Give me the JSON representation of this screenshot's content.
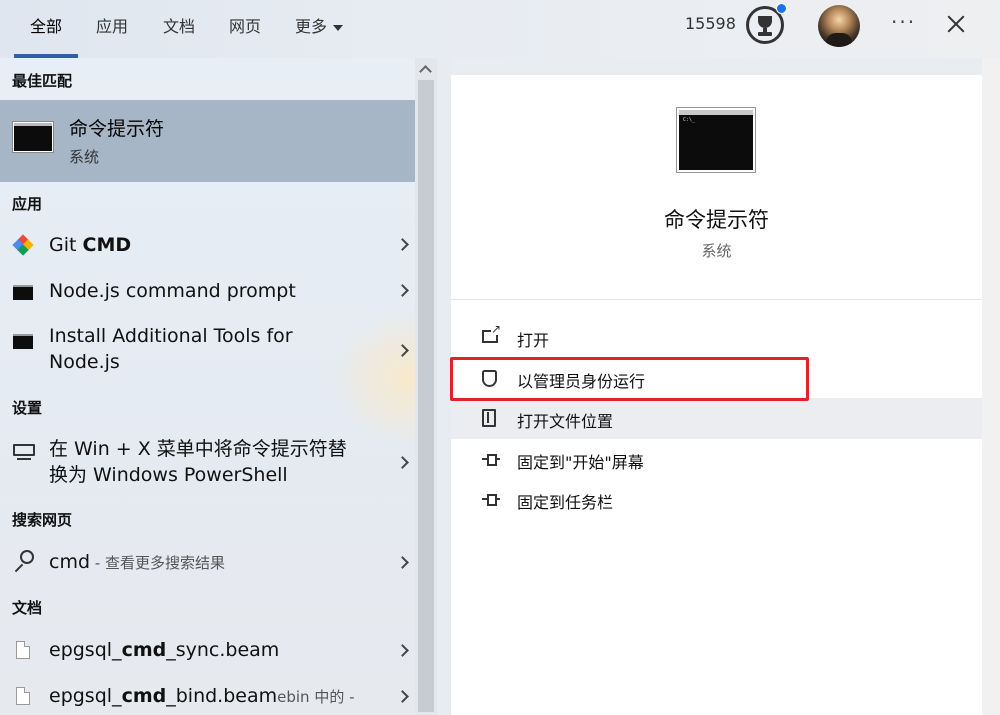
{
  "tabs": [
    {
      "label": "全部",
      "active": true
    },
    {
      "label": "应用"
    },
    {
      "label": "文档"
    },
    {
      "label": "网页"
    },
    {
      "label": "更多"
    }
  ],
  "top_right": {
    "points": "15598",
    "more_icon": "ellipsis-icon",
    "close_icon": "close-icon"
  },
  "sections": {
    "best_match": "最佳匹配",
    "apps": "应用",
    "settings": "设置",
    "web": "搜索网页",
    "docs": "文档"
  },
  "best_match": {
    "title": "命令提示符",
    "subtitle": "系统"
  },
  "apps": [
    {
      "prefix": "Git ",
      "highlight": "CMD",
      "icon": "git-icon"
    },
    {
      "line1": "Node.js command prompt",
      "icon": "terminal-icon"
    },
    {
      "line1": "Install Additional Tools for",
      "line2": "Node.js",
      "icon": "terminal-icon"
    }
  ],
  "settings": [
    {
      "line1": "在 Win + X 菜单中将命令提示符替",
      "line2": "换为 Windows PowerShell",
      "icon": "monitor-icon"
    }
  ],
  "web": [
    {
      "query": "cmd",
      "suffix": " - 查看更多搜索结果",
      "icon": "search-icon"
    }
  ],
  "docs": [
    {
      "prefix": "epgsql_",
      "highlight": "cmd",
      "suffix": "_sync.beam"
    },
    {
      "prefix": "epgsql_",
      "highlight": "cmd",
      "suffix": "_bind.beam",
      "tail": "ebin 中的 -"
    }
  ],
  "detail": {
    "title": "命令提示符",
    "subtitle": "系统",
    "actions": [
      {
        "label": "打开",
        "icon": "open-icon"
      },
      {
        "label": "以管理员身份运行",
        "icon": "shield-icon",
        "highlighted_box": true
      },
      {
        "label": "打开文件位置",
        "icon": "folder-icon"
      },
      {
        "label": "固定到\"开始\"屏幕",
        "icon": "pin-icon"
      },
      {
        "label": "固定到任务栏",
        "icon": "pin-icon"
      }
    ]
  },
  "colors": {
    "accent": "#2f5fa6",
    "selected_row": "#a7b6c7",
    "annotation_red": "#e0232b",
    "notification_dot": "#1a73e8"
  }
}
